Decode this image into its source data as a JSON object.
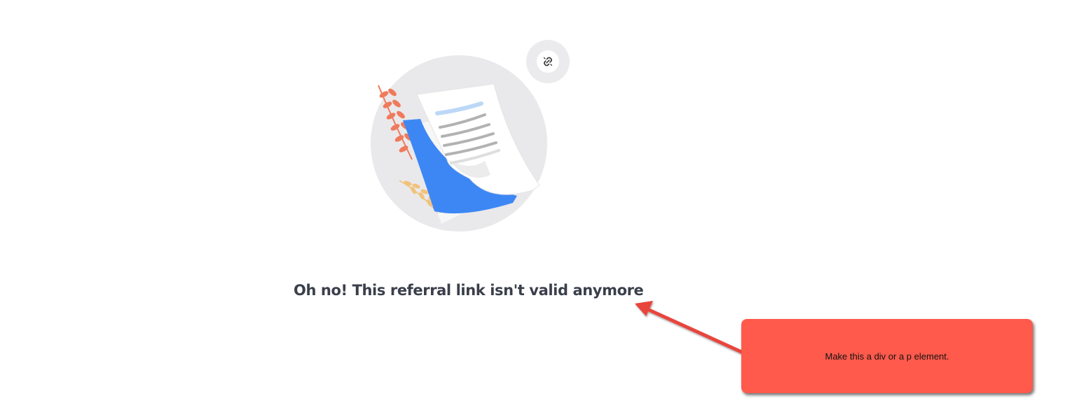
{
  "error": {
    "message": "Oh no! This referral link isn't valid anymore"
  },
  "illustration": {
    "main_icon": "crumpled-document-illustration",
    "badge_icon": "broken-link-icon"
  },
  "annotation": {
    "note": "Make this a div or a p element.",
    "color": "#ff5a4c"
  }
}
